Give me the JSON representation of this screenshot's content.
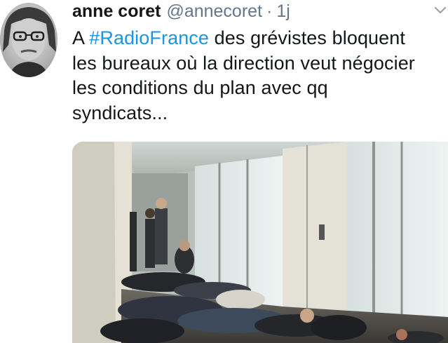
{
  "author": {
    "name": "anne coret",
    "handle": "@annecoret",
    "separator": "·",
    "time": "1j"
  },
  "tweet": {
    "prefix": "A ",
    "hashtag": "#RadioFrance",
    "line1_rest": " des grévistes bloquent",
    "line2": "les bureaux où la direction veut négocier",
    "line3": "les conditions du plan avec qq",
    "line4": "syndicats..."
  },
  "icons": {
    "avatar": "avatar-photo",
    "menu": "chevron-down-icon"
  },
  "colors": {
    "hashtag": "#1b95e0",
    "secondary_text": "#657786",
    "primary_text": "#14171a"
  }
}
